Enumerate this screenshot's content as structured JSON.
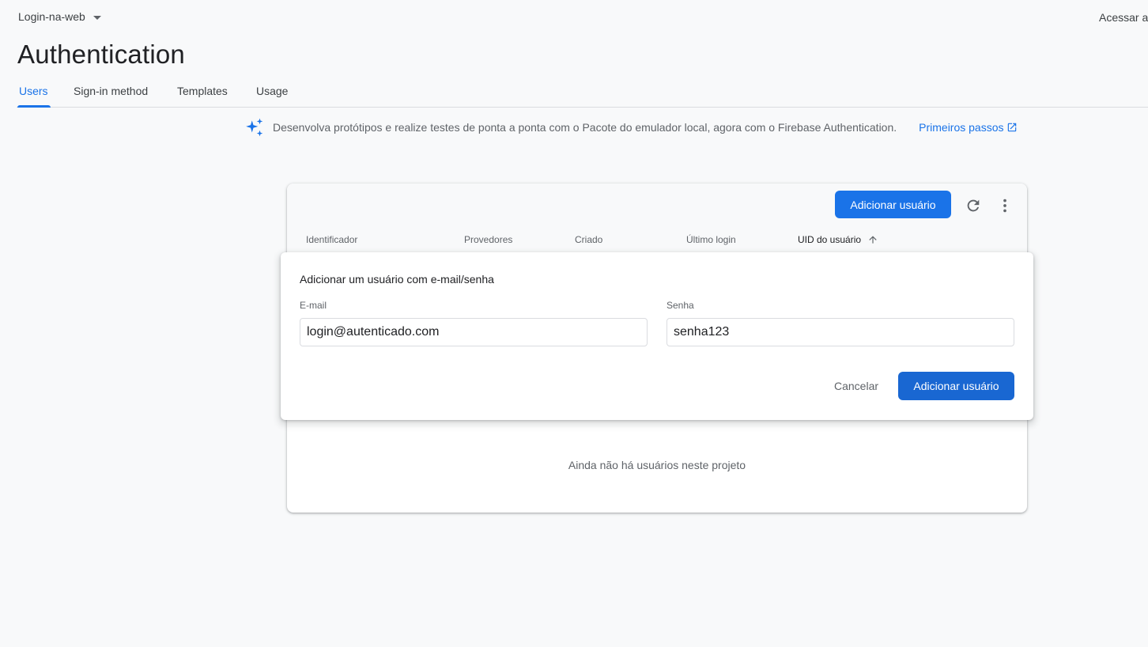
{
  "header": {
    "project_name": "Login-na-web",
    "right_link": "Acessar a",
    "page_title": "Authentication"
  },
  "tabs": [
    {
      "label": "Users",
      "active": true
    },
    {
      "label": "Sign-in method",
      "active": false
    },
    {
      "label": "Templates",
      "active": false
    },
    {
      "label": "Usage",
      "active": false
    }
  ],
  "banner": {
    "icon": "sparkle-icon",
    "text": "Desenvolva protótipos e realize testes de ponta a ponta com o Pacote do emulador local, agora com o Firebase Authentication.",
    "link": "Primeiros passos",
    "link_icon": "open-in-new-icon"
  },
  "users_table": {
    "add_button": "Adicionar usuário",
    "columns": [
      "Identificador",
      "Provedores",
      "Criado",
      "Último login",
      "UID do usuário"
    ],
    "sorted_column": "UID do usuário",
    "sort_icon": "arrow-up-icon",
    "empty_message": "Ainda não há usuários neste projeto"
  },
  "add_user_dialog": {
    "title": "Adicionar um usuário com e-mail/senha",
    "email_label": "E-mail",
    "email_value": "login@autenticado.com",
    "password_label": "Senha",
    "password_value": "senha123",
    "cancel_label": "Cancelar",
    "submit_label": "Adicionar usuário"
  },
  "colors": {
    "accent": "#1a73e8",
    "background": "#f8f9fa",
    "text": "#3c4043"
  }
}
